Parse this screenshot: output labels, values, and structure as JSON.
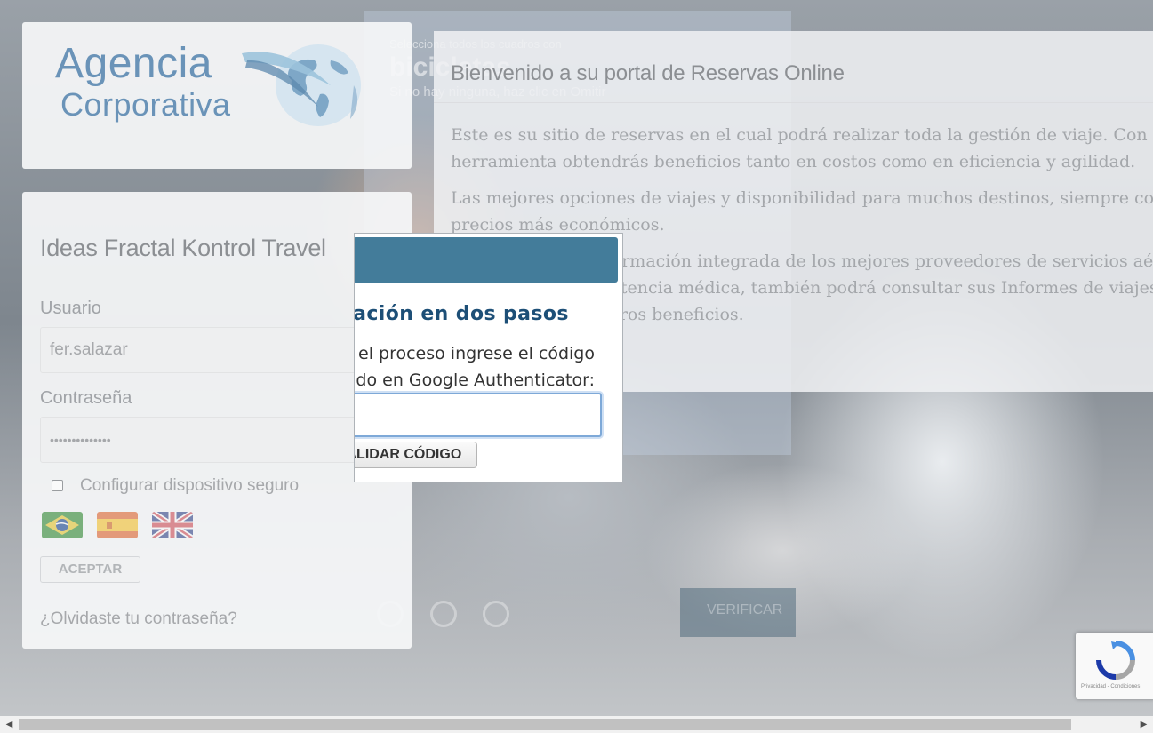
{
  "background": {
    "poster_line1": "Selecciona todos los cuadros con",
    "poster_line2": "bicicletas",
    "poster_line3": "Si no hay ninguna, haz clic en Omitir",
    "monitor_text": "VERIFICAR"
  },
  "logo": {
    "line1": "Agencia",
    "line2": "Corporativa"
  },
  "login": {
    "title": "Ideas Fractal Kontrol Travel",
    "username_label": "Usuario",
    "username_value": "fer.salazar",
    "password_label": "Contraseña",
    "password_value": "••••••••••••••",
    "secure_device_label": "Configurar dispositivo seguro",
    "languages": [
      "Português",
      "Español",
      "English"
    ],
    "accept_button": "ACEPTAR",
    "forgot_link": "¿Olvidaste tu contraseña?"
  },
  "welcome": {
    "title": "Bienvenido a su portal de Reservas Online",
    "paragraphs": [
      [
        "Este es su sitio de reservas en el cual podrá realizar toda la gestión de viaje. Con esta",
        "herramienta obtendrás beneficios tanto en costos como en eficiencia y agilidad."
      ],
      [
        "Las mejores opciones de viajes y disponibilidad para muchos destinos, siempre con los",
        "precios más económicos."
      ],
      [
        "Información integrada de los mejores proveedores de servicios aéreos,",
        "asistencia médica, también podrá consultar sus Informes de viajes",
        "y otros beneficios."
      ]
    ]
  },
  "modal": {
    "title": "Autenticación en dos pasos",
    "text_line1": "Para finalizar el proceso ingrese el código",
    "text_line2": "generado en Google Authenticator:",
    "code_value": "",
    "validate_button": "VALIDAR CÓDIGO"
  },
  "recaptcha": {
    "footer": "Privacidad - Condiciones"
  },
  "colors": {
    "modal_header": "#437c9a",
    "modal_title": "#1d4f77",
    "logo_blue": "#6a93b8"
  }
}
